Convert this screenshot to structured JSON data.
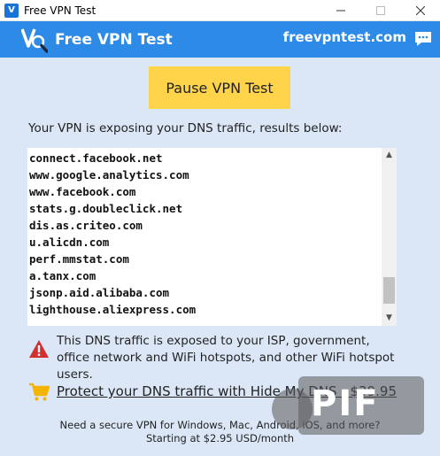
{
  "window": {
    "title": "Free VPN Test",
    "icon_glyph": "V"
  },
  "header": {
    "title": "Free VPN Test",
    "site": "freevpntest.com",
    "icons": [
      "vpn-logo-icon",
      "chat-icon"
    ]
  },
  "pause_button": {
    "label": "Pause VPN Test"
  },
  "intro_text": "Your VPN is exposing your DNS traffic, results below:",
  "dns_entries": [
    "connect.facebook.net",
    "www.google.analytics.com",
    "www.facebook.com",
    "stats.g.doubleclick.net",
    "dis.as.criteo.com",
    "u.alicdn.com",
    "perf.mmstat.com",
    "a.tanx.com",
    "jsonp.aid.alibaba.com",
    "lighthouse.aliexpress.com"
  ],
  "warning": {
    "text": "This DNS traffic is exposed to your ISP, government, office network and WiFi hotspots, and other WiFi hotspot users.",
    "icon": "warning-icon"
  },
  "protect": {
    "label": "Protect your DNS traffic with Hide My DNS - $39.95",
    "icon": "shopping-cart-icon"
  },
  "promo": {
    "line1": "Need a secure VPN for Windows, Mac, Android, iOS, and more?",
    "line2": "Starting at $2.95 USD/month"
  },
  "watermark": {
    "text": "PIF"
  },
  "colors": {
    "header_bg": "#2d8ae6",
    "body_bg": "#dbe7f7",
    "button_bg": "#ffd34a",
    "warning_red": "#d32f2f",
    "cart_yellow": "#f5b400"
  }
}
